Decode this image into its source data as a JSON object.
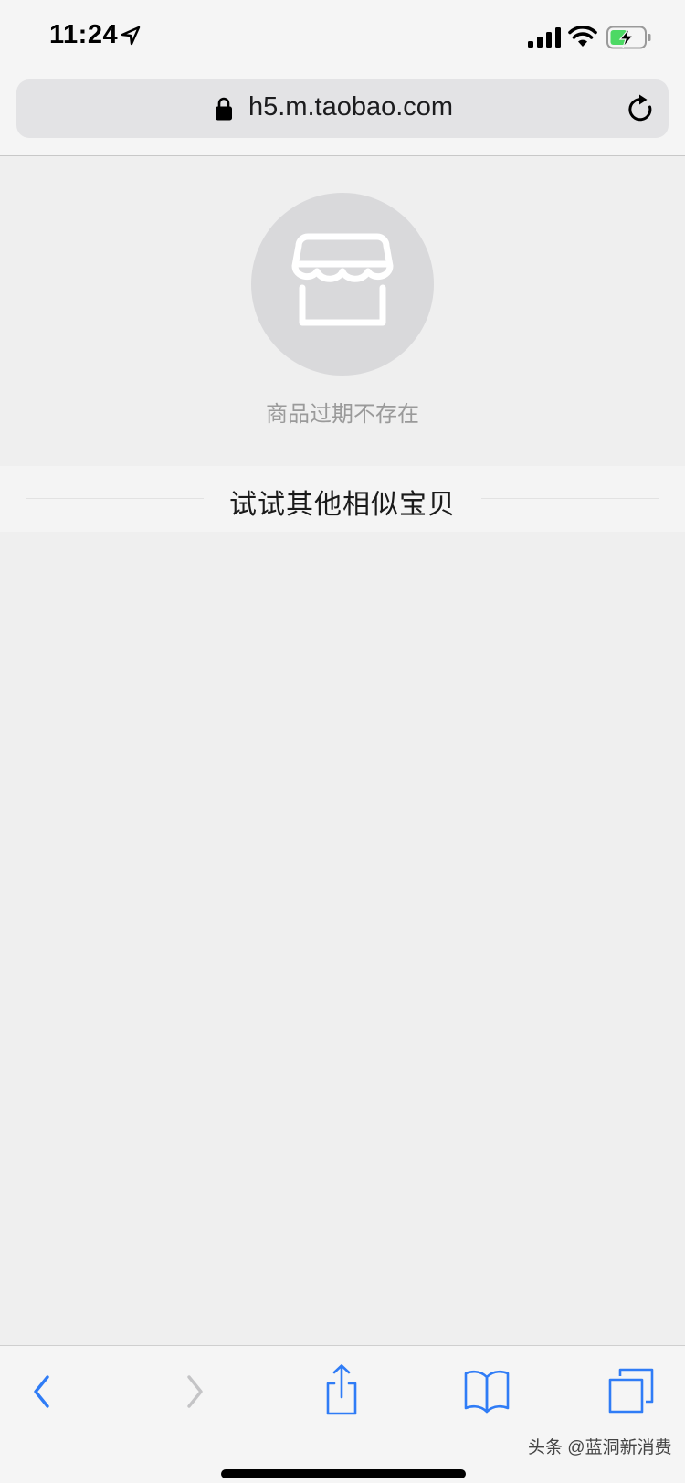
{
  "status_bar": {
    "time": "11:24",
    "icons": [
      "location-arrow-icon",
      "cellular-signal-icon",
      "wifi-icon",
      "battery-charging-icon"
    ],
    "battery_color": "#4cd964"
  },
  "browser": {
    "url": "h5.m.taobao.com",
    "icons": [
      "lock-icon",
      "reload-icon"
    ]
  },
  "empty_state": {
    "icon": "store-icon",
    "message": "商品过期不存在"
  },
  "similar": {
    "title": "试试其他相似宝贝"
  },
  "toolbar": {
    "buttons": [
      "back",
      "forward",
      "share",
      "bookmarks",
      "tabs"
    ],
    "accent_color": "#2f7cf6",
    "disabled_color": "#c4c4c6"
  },
  "watermark": "头条 @蓝洞新消费"
}
